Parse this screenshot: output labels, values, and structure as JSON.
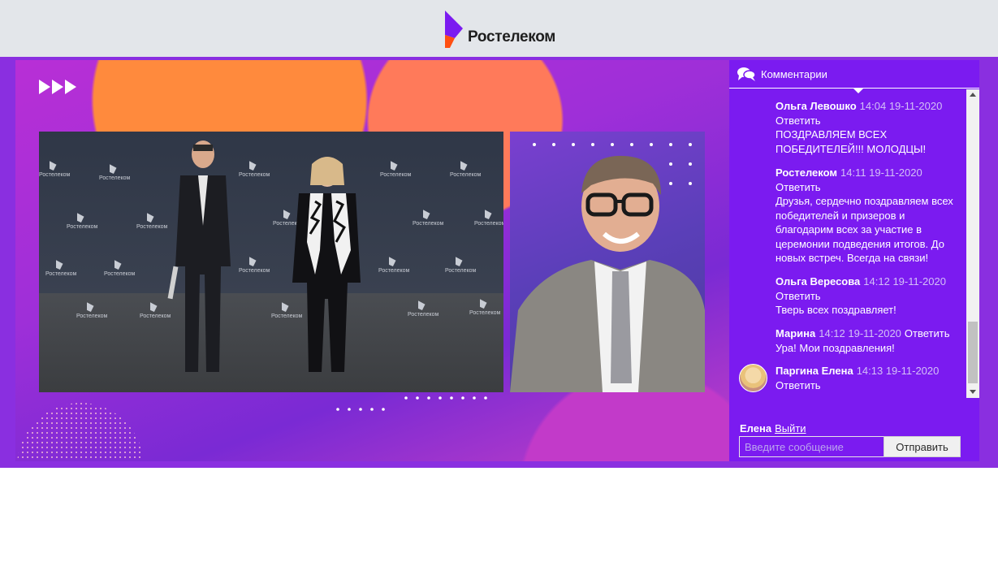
{
  "brand": {
    "name": "Ростелеком",
    "colors": {
      "purple": "#7b1bf0",
      "orange": "#ff4f12"
    }
  },
  "comments_panel": {
    "title": "Комментарии",
    "header_icon": "chat-bubbles-icon",
    "comments": [
      {
        "author": "Ольга Левошко",
        "time": "14:04 19-11-2020",
        "reply": "Ответить",
        "text": "ПОЗДРАВЛЯЕМ ВСЕХ ПОБЕДИТЕЛЕЙ!!! МОЛОДЦЫ!"
      },
      {
        "author": "Ростелеком",
        "time": "14:11 19-11-2020",
        "reply": "Ответить",
        "text": "Друзья, сердечно поздравляем всех победителей и призеров и благодарим всех за участие в церемонии подведения итогов. До новых встреч. Всегда на связи!"
      },
      {
        "author": "Ольга Вересова",
        "time": "14:12 19-11-2020",
        "reply": "Ответить",
        "text": "Тверь всех поздравляет!"
      },
      {
        "author": "Марина",
        "time": "14:12 19-11-2020",
        "reply": "Ответить",
        "text": "Ура! Мои поздравления!"
      },
      {
        "author": "Паргина Елена",
        "time": "14:13 19-11-2020",
        "reply": "Ответить",
        "text": ""
      }
    ]
  },
  "composer": {
    "user_name": "Елена",
    "logout_label": "Выйти",
    "input_placeholder": "Введите сообщение",
    "input_value": "",
    "send_label": "Отправить"
  },
  "video": {
    "skip_icon": "fast-forward-icon",
    "wall_logo_text": "Ростелеком"
  }
}
